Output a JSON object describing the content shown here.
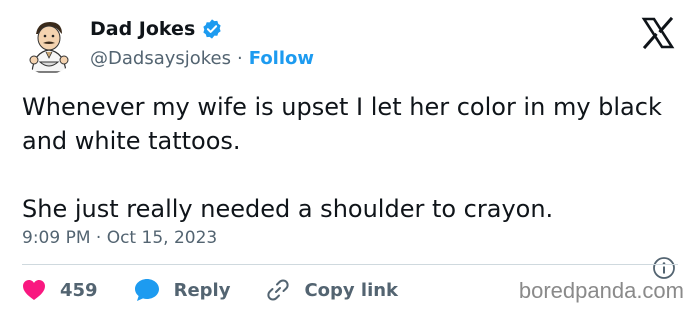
{
  "author": {
    "display_name": "Dad Jokes",
    "handle": "@Dadsaysjokes",
    "separator": "·",
    "follow_label": "Follow",
    "verified": true
  },
  "tweet": {
    "paragraph_1": "Whenever my wife is upset I let her color in my black and white tattoos.",
    "paragraph_2": "She just really needed a shoulder to crayon.",
    "timestamp": "9:09 PM · Oct 15, 2023"
  },
  "actions": {
    "like_count": "459",
    "reply_label": "Reply",
    "copy_link_label": "Copy link"
  },
  "watermark": "boredpanda.com",
  "icons": {
    "avatar": "cartoon-chef-avatar",
    "verified": "verified-badge-icon",
    "logo": "x-logo-icon",
    "info": "info-icon",
    "like": "heart-icon",
    "reply": "speech-bubble-icon",
    "copy_link": "link-icon"
  },
  "colors": {
    "accent": "#1d9bf0",
    "like": "#f91880",
    "text": "#0f1419",
    "muted": "#536471",
    "divider": "#cfd9de"
  }
}
